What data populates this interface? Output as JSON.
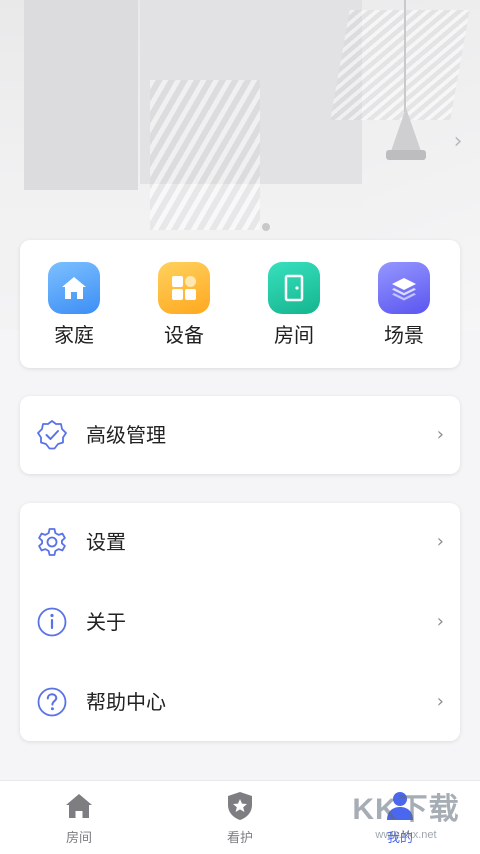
{
  "hero": {
    "next_glyph": "›"
  },
  "quick_actions": [
    {
      "label": "家庭",
      "icon": "home-icon",
      "color_from": "#6fb6ff",
      "color_to": "#3d8ef5"
    },
    {
      "label": "设备",
      "icon": "device-grid-icon",
      "color_from": "#ffc94d",
      "color_to": "#ffa81f"
    },
    {
      "label": "房间",
      "icon": "door-icon",
      "color_from": "#2fd8b5",
      "color_to": "#14b58e"
    },
    {
      "label": "场景",
      "icon": "layers-icon",
      "color_from": "#8a8cff",
      "color_to": "#5b55f0"
    }
  ],
  "advanced": {
    "label": "高级管理",
    "icon": "shield-check-icon",
    "chevron": "›"
  },
  "menu": [
    {
      "label": "设置",
      "icon": "gear-icon",
      "chevron": "›"
    },
    {
      "label": "关于",
      "icon": "info-icon",
      "chevron": "›"
    },
    {
      "label": "帮助中心",
      "icon": "help-icon",
      "chevron": "›"
    }
  ],
  "tabs": [
    {
      "label": "房间",
      "icon": "house-icon",
      "active": false
    },
    {
      "label": "看护",
      "icon": "shield-star-icon",
      "active": false
    },
    {
      "label": "我的",
      "icon": "person-icon",
      "active": true
    }
  ],
  "watermark": {
    "big": "KK下载",
    "small": "www.kkx.net"
  },
  "colors": {
    "accent": "#4a67f0",
    "icon_outline": "#5a72e8",
    "tab_inactive": "#7d7d82"
  }
}
